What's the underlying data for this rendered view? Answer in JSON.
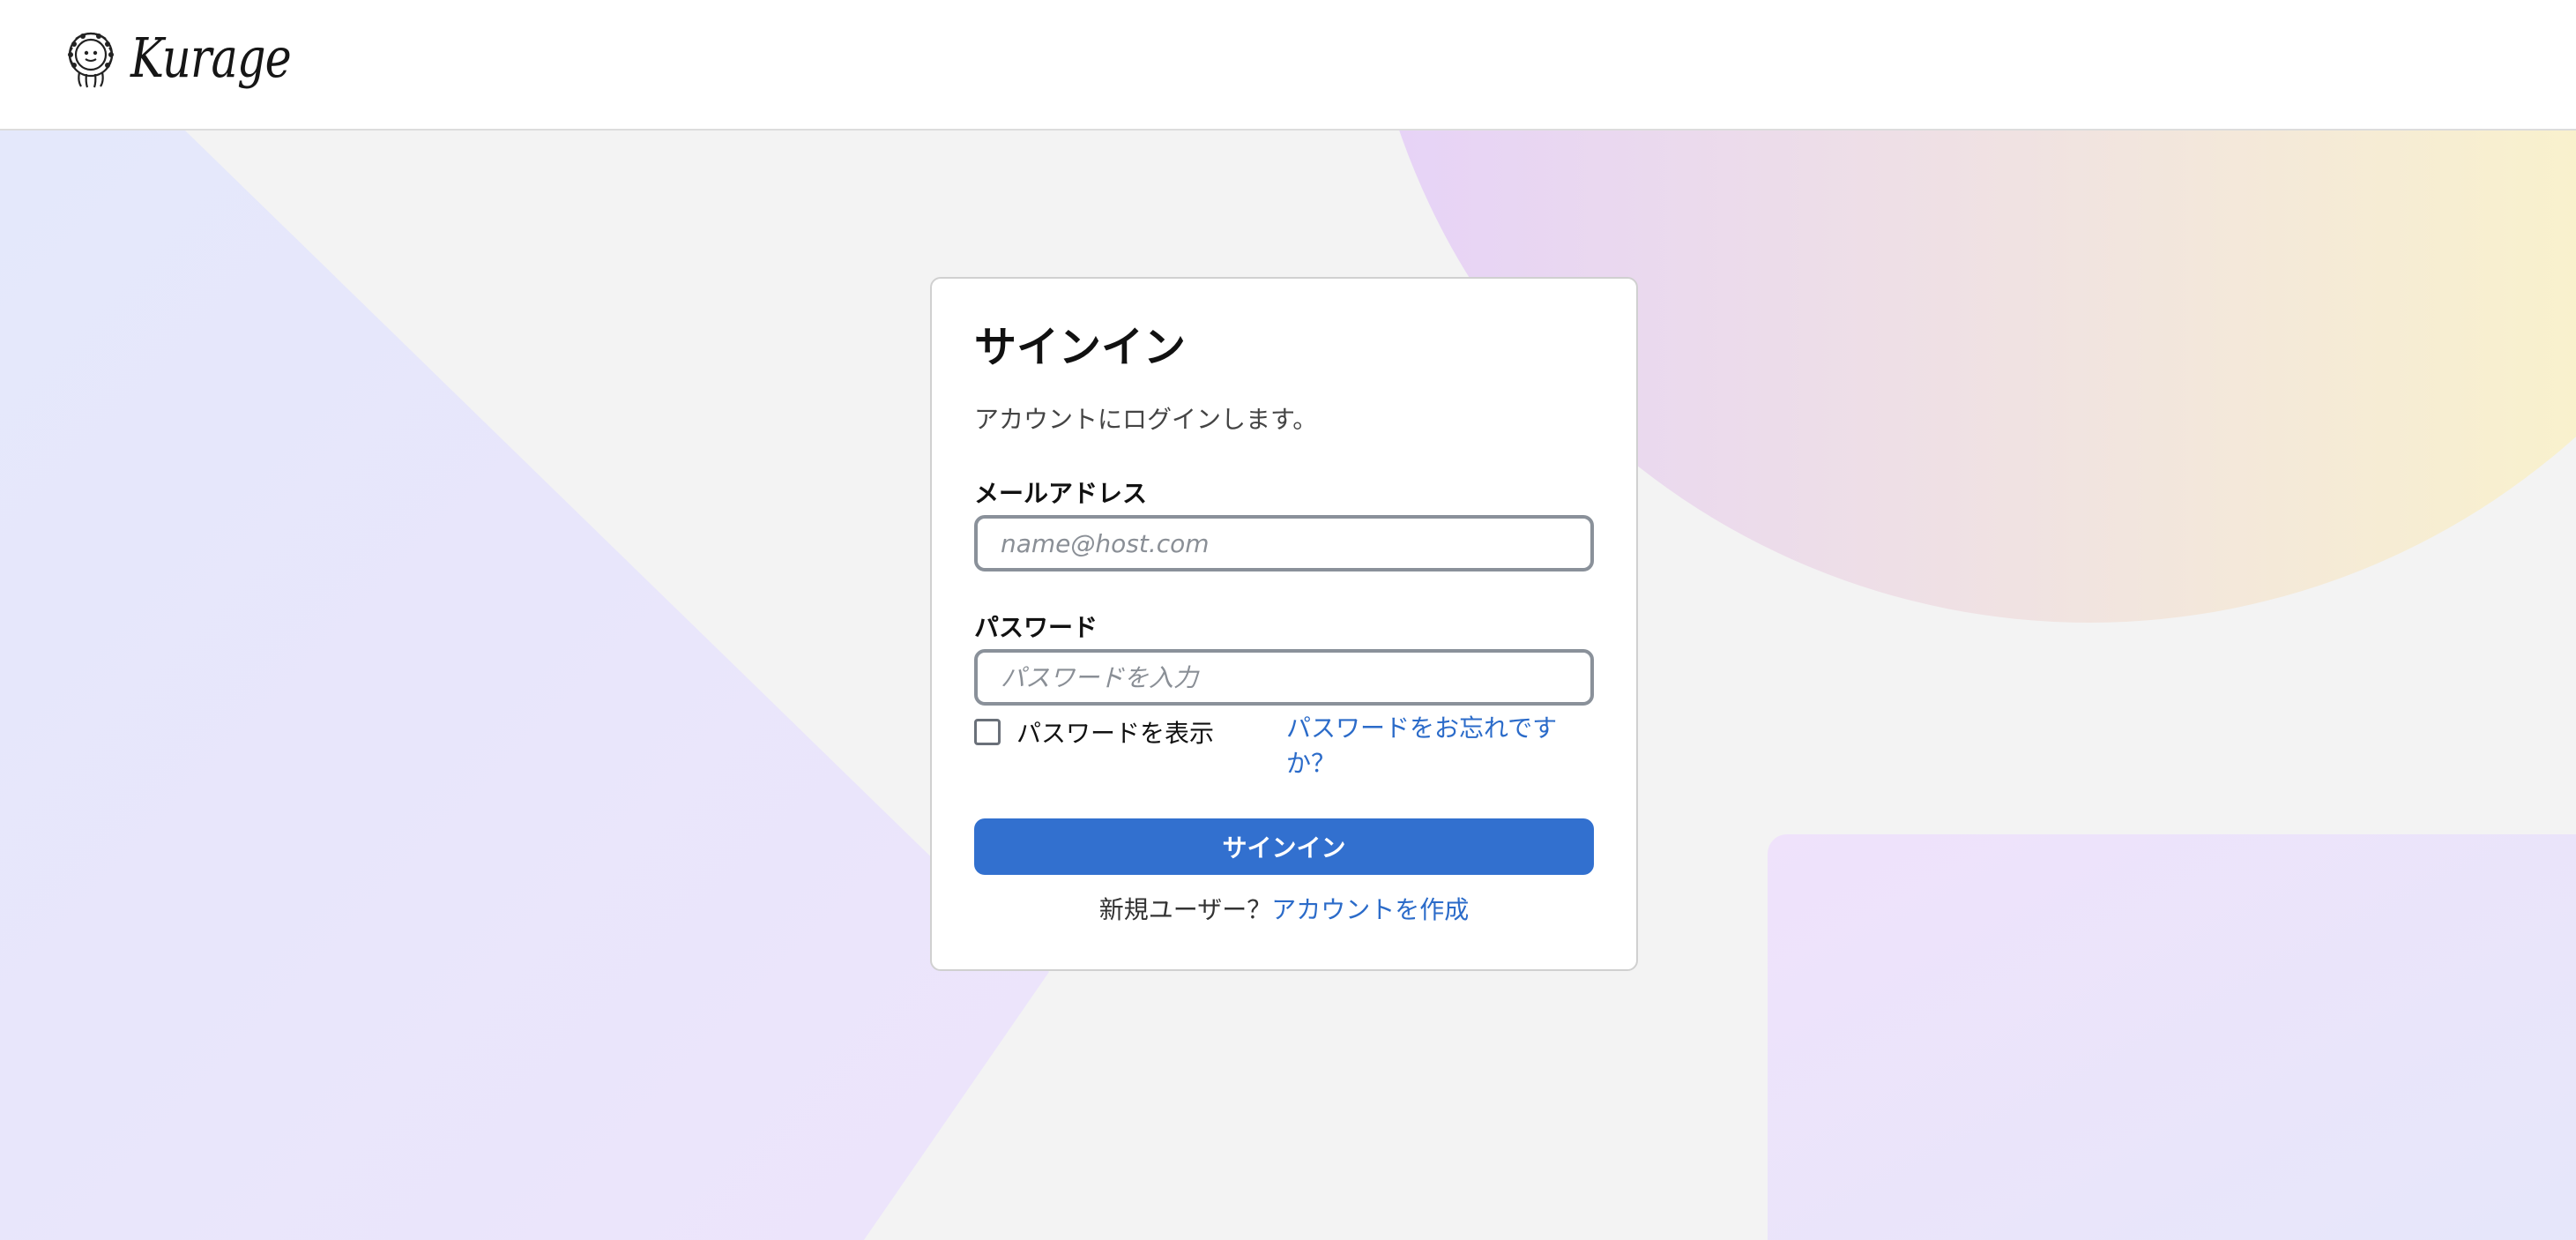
{
  "header": {
    "logo_text": "Kurage",
    "logo_icon": "jellyfish-logo-icon"
  },
  "signin": {
    "title": "サインイン",
    "subtitle": "アカウントにログインします。",
    "email_label": "メールアドレス",
    "email_placeholder": "name@host.com",
    "email_value": "",
    "password_label": "パスワード",
    "password_placeholder": "パスワードを入力",
    "password_value": "",
    "show_password_label": "パスワードを表示",
    "show_password_checked": false,
    "forgot_password_link": "パスワードをお忘れですか？",
    "submit_label": "サインイン",
    "new_user_text": "新規ユーザー？",
    "create_account_link": "アカウントを作成"
  },
  "colors": {
    "primary": "#3270cf",
    "link": "#2b6bc9",
    "background": "#f3f3f3"
  }
}
